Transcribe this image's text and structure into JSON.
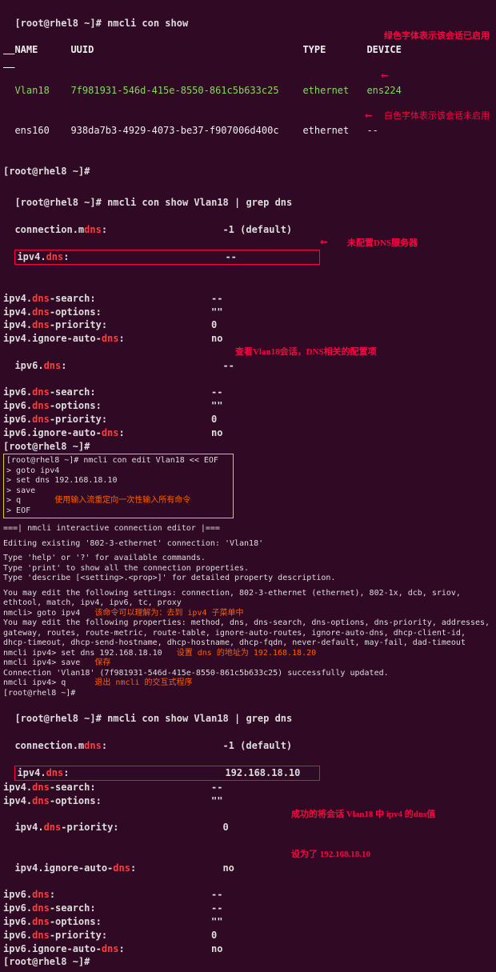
{
  "prompt": "[root@rhel8 ~]#",
  "cmd_con_show": "nmcli con show",
  "header": {
    "name": "NAME",
    "uuid": "UUID",
    "type": "TYPE",
    "device": "DEVICE"
  },
  "rows": [
    {
      "name": "Vlan18",
      "uuid": "7f981931-546d-415e-8550-861c5b633c25",
      "type": "ethernet",
      "device": "ens224"
    },
    {
      "name": "ens160",
      "uuid": "938da7b3-4929-4073-be37-f907006d400c",
      "type": "ethernet",
      "device": "--"
    }
  ],
  "annot_green": "绿色字体表示该会话已启用",
  "annot_white": "白色字体表示该会话未启用",
  "cmd_show_grep": "nmcli con show Vlan18 | grep dns",
  "kv1": [
    [
      "connection.mdns:",
      "-1 (default)"
    ],
    [
      "ipv4.dns:",
      "--"
    ],
    [
      "ipv4.dns-search:",
      "--"
    ],
    [
      "ipv4.dns-options:",
      "\"\""
    ],
    [
      "ipv4.dns-priority:",
      "0"
    ],
    [
      "ipv4.ignore-auto-dns:",
      "no"
    ],
    [
      "ipv6.dns:",
      "--"
    ],
    [
      "ipv6.dns-search:",
      "--"
    ],
    [
      "ipv6.dns-options:",
      "\"\""
    ],
    [
      "ipv6.dns-priority:",
      "0"
    ],
    [
      "ipv6.ignore-auto-dns:",
      "no"
    ]
  ],
  "annot_nodns": "未配置DNS服务器",
  "annot_viewcfg": "查看Vlan18会话，DNS相关的配置项",
  "heredoc": {
    "cmd": "nmcli con edit Vlan18 << EOF",
    "lines": [
      "goto ipv4",
      "set dns 192.168.18.10",
      "save",
      "q",
      "EOF"
    ],
    "annot": "使用输入流重定向一次性输入所有命令"
  },
  "editor": {
    "header": "===| nmcli interactive connection editor |===",
    "editing": "Editing existing '802-3-ethernet' connection: 'Vlan18'",
    "help1": "Type 'help' or '?' for available commands.",
    "help2": "Type 'print' to show all the connection properties.",
    "help3": "Type 'describe [<setting>.<prop>]' for detailed property description.",
    "settings": "You may edit the following settings: connection, 802-3-ethernet (ethernet), 802-1x, dcb, sriov, ethtool, match, ipv4, ipv6, tc, proxy",
    "goto_cmd": "nmcli> goto ipv4",
    "goto_annot": "该命令可以理解为：去到 ipv4 子菜单中",
    "props": "You may edit the following properties: method, dns, dns-search, dns-options, dns-priority, addresses, gateway, routes, route-metric, route-table, ignore-auto-routes, ignore-auto-dns, dhcp-client-id, dhcp-timeout, dhcp-send-hostname, dhcp-hostname, dhcp-fqdn, never-default, may-fail, dad-timeout",
    "set_cmd": "nmcli ipv4> set dns 192.168.18.10",
    "set_annot": "设置 dns 的地址为 192.168.18.20",
    "save_cmd": "nmcli ipv4> save",
    "save_annot": "保存",
    "saved_msg": "Connection 'Vlan18' (7f981931-546d-415e-8550-861c5b633c25) successfully updated.",
    "quit_cmd": "nmcli ipv4> q",
    "quit_annot": "退出 nmcli 的交互式程序"
  },
  "kv2": [
    [
      "connection.mdns:",
      "-1 (default)"
    ],
    [
      "ipv4.dns:",
      "192.168.18.10"
    ],
    [
      "ipv4.dns-search:",
      "--"
    ],
    [
      "ipv4.dns-options:",
      "\"\""
    ],
    [
      "ipv4.dns-priority:",
      "0"
    ],
    [
      "ipv4.ignore-auto-dns:",
      "no"
    ],
    [
      "ipv6.dns:",
      "--"
    ],
    [
      "ipv6.dns-search:",
      "--"
    ],
    [
      "ipv6.dns-options:",
      "\"\""
    ],
    [
      "ipv6.dns-priority:",
      "0"
    ],
    [
      "ipv6.ignore-auto-dns:",
      "no"
    ]
  ],
  "annot_success_l1": "成功的将会话 Vlan18 中 ipv4 的dns值",
  "annot_success_l2": "设为了 192.168.18.10"
}
